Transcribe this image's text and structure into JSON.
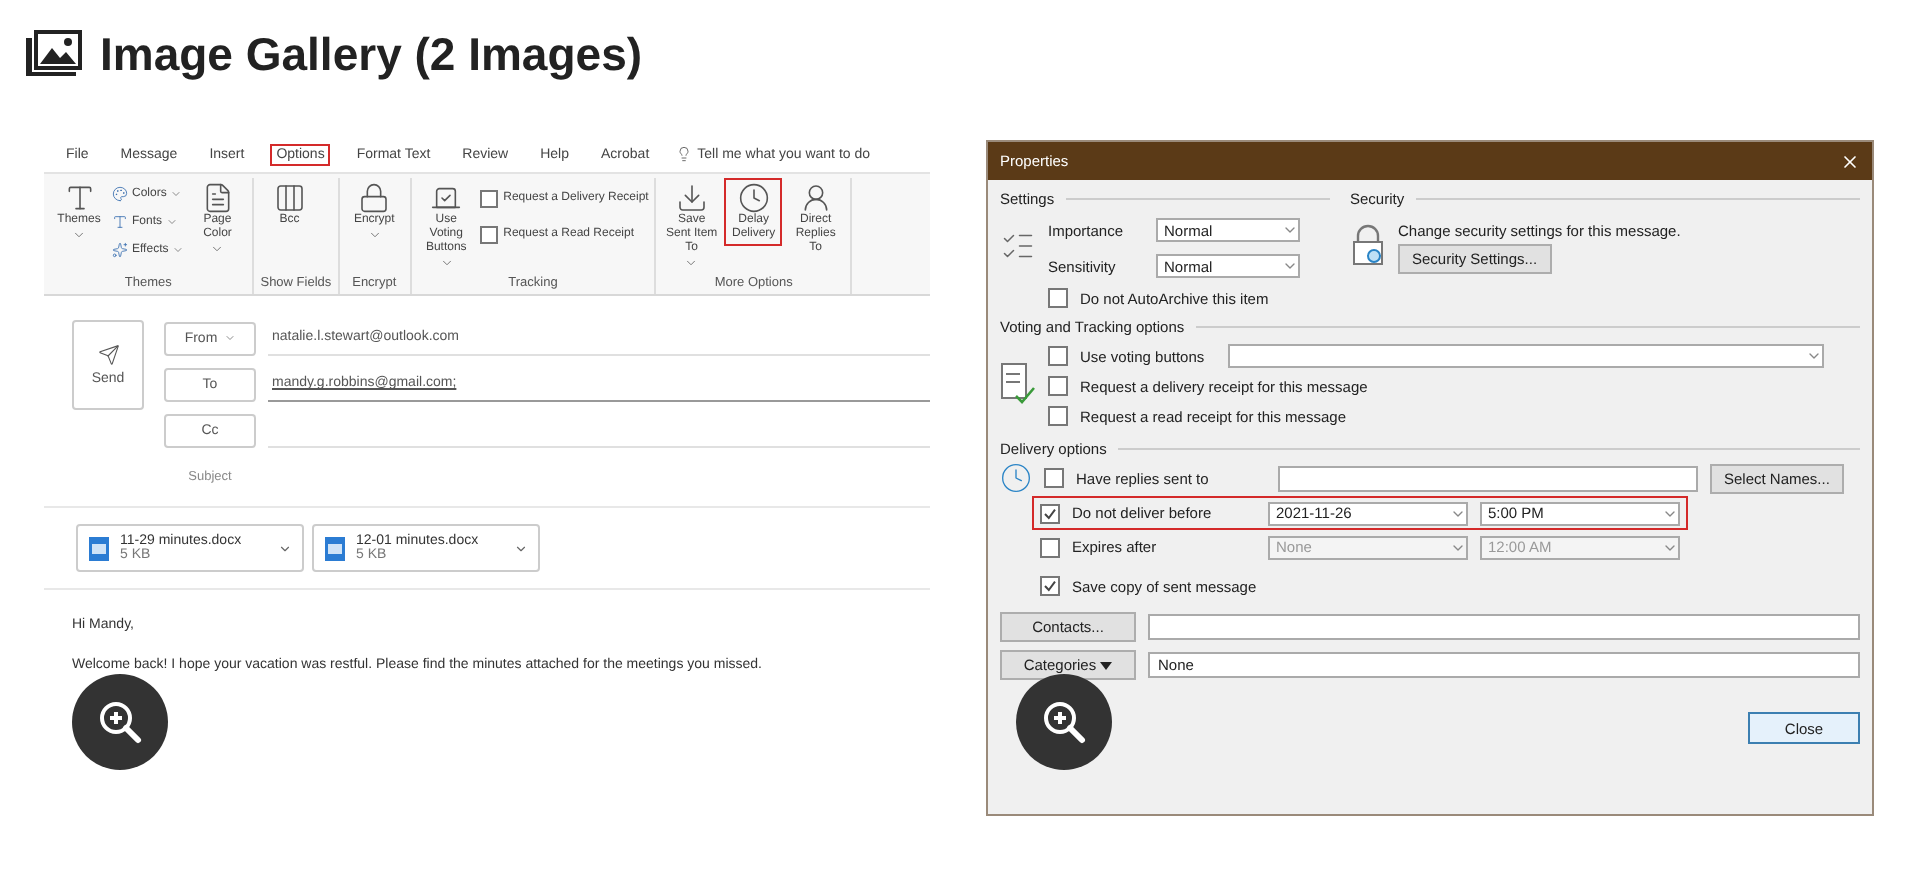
{
  "header": {
    "title": "Image Gallery (2 Images)"
  },
  "email": {
    "tabs": [
      {
        "label": "File",
        "selected": false
      },
      {
        "label": "Message",
        "selected": false
      },
      {
        "label": "Insert",
        "selected": false
      },
      {
        "label": "Options",
        "selected": true
      },
      {
        "label": "Format Text",
        "selected": false
      },
      {
        "label": "Review",
        "selected": false
      },
      {
        "label": "Help",
        "selected": false
      },
      {
        "label": "Acrobat",
        "selected": false
      }
    ],
    "tell_me": "Tell me what you want to do",
    "groups": [
      {
        "label": "Themes",
        "items": [
          {
            "kind": "large",
            "label": "Themes",
            "menu": true,
            "highlighted": false
          },
          {
            "kind": "stack",
            "entries": [
              {
                "label": "Colors",
                "menu": true
              },
              {
                "label": "Fonts",
                "menu": true
              },
              {
                "label": "Effects",
                "menu": true
              }
            ]
          },
          {
            "kind": "large",
            "label": "Page Color",
            "menu": true,
            "highlighted": false
          }
        ]
      },
      {
        "label": "Show Fields",
        "items": [
          {
            "kind": "large",
            "label": "Bcc",
            "menu": false,
            "highlighted": false
          }
        ]
      },
      {
        "label": "Encrypt",
        "items": [
          {
            "kind": "large",
            "label": "Encrypt",
            "menu": true,
            "highlighted": false
          }
        ]
      },
      {
        "label": "Tracking",
        "items": [
          {
            "kind": "large",
            "label": "Use Voting Buttons",
            "menu": true,
            "highlighted": false
          },
          {
            "kind": "checks",
            "entries": [
              {
                "label": "Request a Delivery Receipt",
                "checked": false
              },
              {
                "label": "Request a Read Receipt",
                "checked": false
              }
            ]
          }
        ]
      },
      {
        "label": "More Options",
        "items": [
          {
            "kind": "large",
            "label": "Save Sent Item To",
            "menu": true,
            "highlighted": false
          },
          {
            "kind": "large",
            "label": "Delay Delivery",
            "menu": false,
            "highlighted": true
          },
          {
            "kind": "large",
            "label": "Direct Replies To",
            "menu": false,
            "highlighted": false
          }
        ]
      }
    ],
    "send": "Send",
    "fields": [
      {
        "label": "From",
        "menu": true,
        "value": "natalie.l.stewart@outlook.com",
        "link": false
      },
      {
        "label": "To",
        "menu": false,
        "value": "mandy.g.robbins@gmail.com;",
        "link": true
      },
      {
        "label": "Cc",
        "menu": false,
        "link": false
      }
    ],
    "subject": "Subject",
    "attachments": [
      {
        "name": "11-29 minutes.docx",
        "size": "5 KB"
      },
      {
        "name": "12-01 minutes.docx",
        "size": "5 KB"
      }
    ],
    "body": [
      "Hi Mandy,",
      "Welcome back! I hope your vacation was restful. Please find the minutes attached for the meetings you missed."
    ]
  },
  "dialog": {
    "title": "Properties",
    "settings": {
      "label": "Settings",
      "rows": [
        {
          "label": "Importance",
          "value": "Normal"
        },
        {
          "label": "Sensitivity",
          "value": "Normal"
        }
      ],
      "archive": {
        "label": "Do not AutoArchive this item",
        "checked": false
      }
    },
    "security": {
      "label": "Security",
      "text": "Change security settings for this message.",
      "button": "Security Settings..."
    },
    "voting": {
      "label": "Voting and Tracking options",
      "checks": [
        {
          "label": "Use voting buttons",
          "checked": false
        },
        {
          "label": "Request a delivery receipt for this message",
          "checked": false
        },
        {
          "label": "Request a read receipt for this message",
          "checked": false
        }
      ]
    },
    "delivery": {
      "label": "Delivery options",
      "replies": {
        "label": "Have replies sent to",
        "checked": false,
        "button": "Select Names..."
      },
      "timed": [
        {
          "label": "Do not deliver before",
          "checked": true,
          "date": "2021-11-26",
          "time": "5:00 PM",
          "highlighted": true,
          "disabled": false
        },
        {
          "label": "Expires after",
          "checked": false,
          "date": "None",
          "time": "12:00 AM",
          "highlighted": false,
          "disabled": true
        }
      ],
      "save": {
        "label": "Save copy of sent message",
        "checked": true
      }
    },
    "contacts": {
      "button": "Contacts..."
    },
    "categories": {
      "button": "Categories",
      "value": "None"
    },
    "close": "Close"
  }
}
